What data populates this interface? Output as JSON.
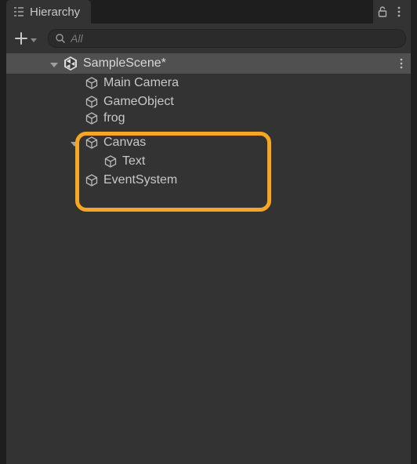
{
  "panel": {
    "title": "Hierarchy"
  },
  "toolbar": {
    "search_placeholder": "All"
  },
  "scene": {
    "name": "SampleScene*"
  },
  "items": {
    "main_camera": "Main Camera",
    "game_object": "GameObject",
    "frog": "frog",
    "canvas": "Canvas",
    "text": "Text",
    "event_system": "EventSystem"
  },
  "colors": {
    "highlight": "#f5a623",
    "panel_bg": "#333333",
    "row_selected": "#505050"
  }
}
